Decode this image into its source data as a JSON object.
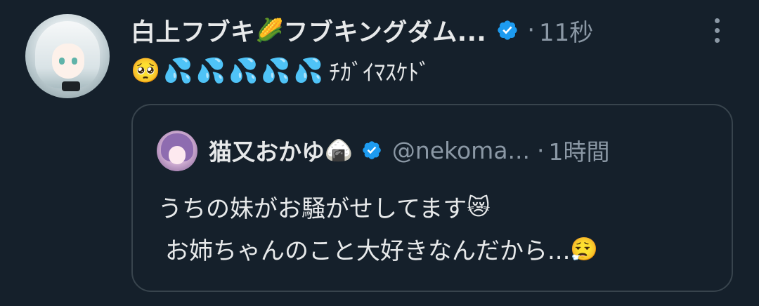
{
  "tweet": {
    "author_name": "白上フブキ",
    "author_emoji": "🌽",
    "author_name_suffix": "フブキングダム...",
    "separator": "·",
    "time": "11秒",
    "emojis": [
      "🥺",
      "💦",
      "💦",
      "💦",
      "💦",
      "💦"
    ],
    "text": "ﾁｶﾞｲﾏｽｹﾄﾞ"
  },
  "quote": {
    "author_name": "猫又おかゆ",
    "author_emoji": "🍙",
    "handle": "@nekoma...",
    "separator": "·",
    "time": "1時間",
    "line1_text": "うちの妹がお騒がせしてます",
    "line1_emoji": "😿",
    "line2_text": "お姉ちゃんのこと大好きなんだから...",
    "line2_emoji": "😮‍💨"
  },
  "colors": {
    "background": "#15202b",
    "text": "#e7e9ea",
    "muted": "#8b98a5",
    "verified": "#1d9bf0",
    "border": "#38444d"
  },
  "icons": {
    "verified": "verified-badge-icon",
    "more": "more-vertical-icon"
  }
}
